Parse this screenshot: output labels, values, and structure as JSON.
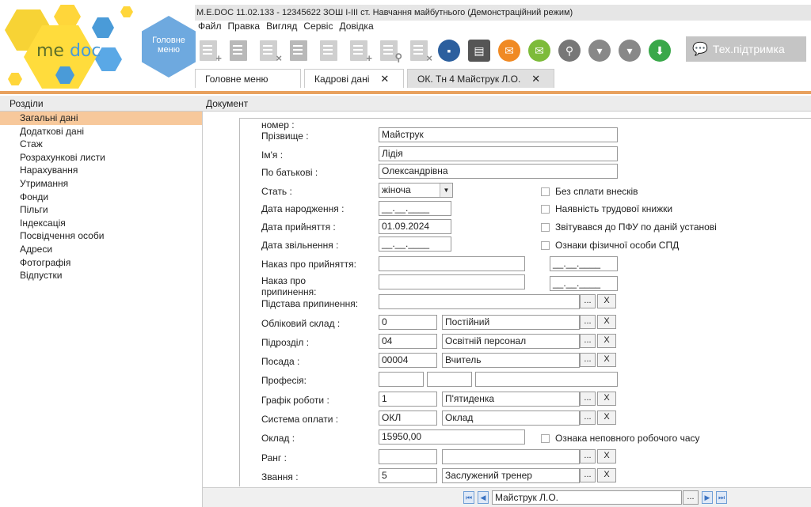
{
  "window": {
    "title": "M.E.DOC 11.02.133 - 12345622 ЗОШ І-ІІІ ст. Навчання майбутнього (Демонстраційний режим)"
  },
  "logo": {
    "me": "me",
    "doc": "doc",
    "accent": "#ffd63a"
  },
  "home": {
    "label": "Головне меню"
  },
  "menu": [
    "Файл",
    "Правка",
    "Вигляд",
    "Сервіс",
    "Довідка"
  ],
  "toolbar": {
    "support_label": "Тех.підтримка"
  },
  "tabs": [
    {
      "label": "Головне меню"
    },
    {
      "label": "Кадрові дані"
    },
    {
      "label": "ОК. Тн 4 Майструк Л.О."
    }
  ],
  "sidebar": {
    "header": "Розділи",
    "items": [
      "Загальні дані",
      "Додаткові дані",
      "Стаж",
      "Розрахункові листи",
      "Нарахування",
      "Утримання",
      "Фонди",
      "Пільги",
      "Індексація",
      "Посвідчення особи",
      "Адреси",
      "Фотографія",
      "Відпустки"
    ]
  },
  "document": {
    "header": "Документ"
  },
  "form": {
    "cut_label": "номер :",
    "surname_label": "Прізвище :",
    "surname": "Майструк",
    "name_label": "Ім'я :",
    "name": "Лідія",
    "patronymic_label": "По батькові :",
    "patronymic": "Олександрівна",
    "gender_label": "Стать :",
    "gender": "жіноча",
    "birth_label": "Дата народження :",
    "birth": "__.__.____",
    "hire_label": "Дата прийняття :",
    "hire": "01.09.2024",
    "fire_label": "Дата звільнення :",
    "fire": "__.__.____",
    "hire_order_label": "Наказ про прийняття:",
    "hire_order_date": "__.__.____",
    "fire_order_label": "Наказ про припинення:",
    "fire_order_date": "__.__.____",
    "fire_reason_label": "Підстава припинення:",
    "staff_label": "Обліковий склад :",
    "staff_code": "0",
    "staff_name": "Постійний",
    "dept_label": "Підрозділ :",
    "dept_code": "04",
    "dept_name": "Освітній персонал",
    "position_label": "Посада :",
    "position_code": "00004",
    "position_name": "Вчитель",
    "profession_label": "Професія:",
    "schedule_label": "Графік роботи :",
    "schedule_code": "1",
    "schedule_name": "П'ятиденка",
    "pay_label": "Система оплати :",
    "pay_code": "ОКЛ",
    "pay_name": "Оклад",
    "salary_label": "Оклад :",
    "salary": "15950,00",
    "rank_label": "Ранг :",
    "title_label": "Звання :",
    "title_code": "5",
    "title_name": "Заслужений тренер",
    "checks": [
      "Без сплати внесків",
      "Наявність трудової книжки",
      "Звітувався до ПФУ по даній установі",
      "Ознаки фізичної особи СПД",
      "Ознака неповного робочого часу"
    ],
    "dots": "...",
    "x": "X"
  },
  "navigator": {
    "current": "Майструк Л.О."
  }
}
